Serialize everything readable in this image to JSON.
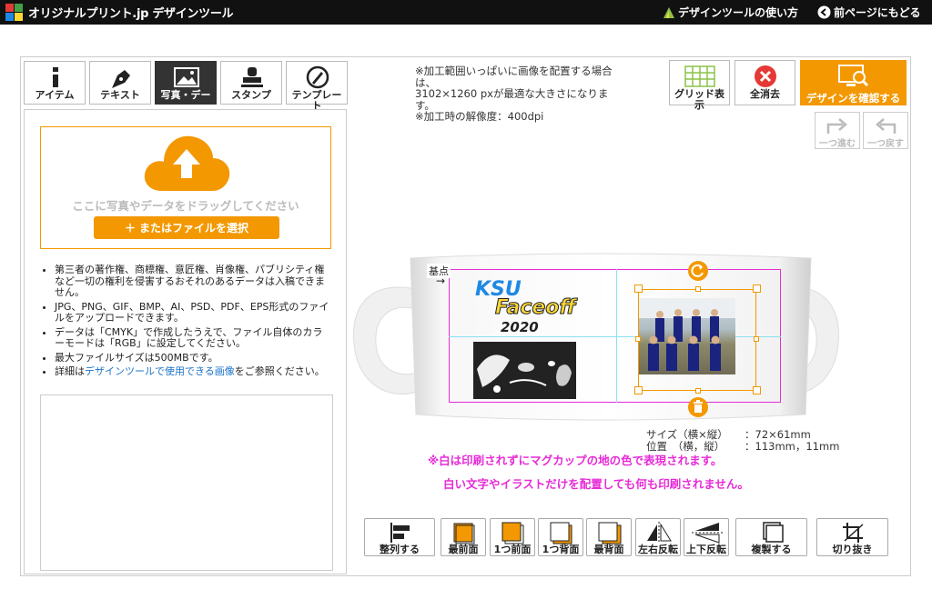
{
  "header": {
    "logo_text": "オリジナルプリント.jp デザインツール",
    "help_link": "デザインツールの使い方",
    "back_link": "前ページにもどる"
  },
  "tabs": [
    {
      "label": "アイテム",
      "icon": "info-icon",
      "active": false
    },
    {
      "label": "テキスト",
      "icon": "pen-icon",
      "active": false
    },
    {
      "label": "写真・デー",
      "icon": "image-icon",
      "active": true
    },
    {
      "label": "スタンプ",
      "icon": "stamp-icon",
      "active": false
    },
    {
      "label": "テンプレー\nト",
      "icon": "template-icon",
      "active": false
    }
  ],
  "upload": {
    "drop_text": "ここに写真やデータをドラッグしてください",
    "select_button": "またはファイルを選択"
  },
  "notes": {
    "n1": "第三者の著作権、商標権、意匠権、肖像権、パブリシティ権など一切の権利を侵害するおそれのあるデータは入稿できません。",
    "n2": "JPG、PNG、GIF、BMP、AI、PSD、PDF、EPS形式のファイルをアップロードできます。",
    "n3": "データは「CMYK」で作成したうえで、ファイル自体のカラーモードは「RGB」に設定してください。",
    "n4": "最大ファイルサイズは500MBです。",
    "n5_pre": "詳細は",
    "n5_link": "デザインツールで使用できる画像",
    "n5_post": "をご参照ください。"
  },
  "info": {
    "line1": "※加工範囲いっぱいに画像を配置する場合は、",
    "line2": "3102×1260 pxが最適な大きさになります。",
    "line3": "※加工時の解像度：400dpi"
  },
  "tools": {
    "grid": "グリッド表示",
    "clear": "全消去",
    "confirm": "デザインを確認する",
    "redo": "一つ進む",
    "undo": "一つ戻す"
  },
  "canvas": {
    "origin_label": "基点",
    "logo_line1": "KSU",
    "logo_line2": "Faceoff",
    "logo_year": "2020"
  },
  "size_info": {
    "size_label": "サイズ（横×縦）",
    "size_value": "：72×61mm",
    "pos_label": "位置　（横，縦）",
    "pos_value": "：113mm，11mm"
  },
  "warnings": {
    "w1": "※白は印刷されずにマグカップの地の色で表現されます。",
    "w2": "白い文字やイラストだけを配置しても何も印刷されません。"
  },
  "bottom_tools": [
    {
      "label": "整列する",
      "icon": "align-icon"
    },
    {
      "label": "最前面",
      "icon": "bring-front-icon"
    },
    {
      "label": "1つ前面",
      "icon": "bring-forward-icon"
    },
    {
      "label": "1つ背面",
      "icon": "send-backward-icon"
    },
    {
      "label": "最背面",
      "icon": "send-back-icon"
    },
    {
      "label": "左右反転",
      "icon": "flip-horizontal-icon"
    },
    {
      "label": "上下反転",
      "icon": "flip-vertical-icon"
    },
    {
      "label": "複製する",
      "icon": "duplicate-icon"
    },
    {
      "label": "切り抜き",
      "icon": "crop-icon"
    }
  ],
  "colors": {
    "accent": "#f39800",
    "danger": "#e53935",
    "guide": "#e62bd7",
    "link": "#1a73c8"
  }
}
